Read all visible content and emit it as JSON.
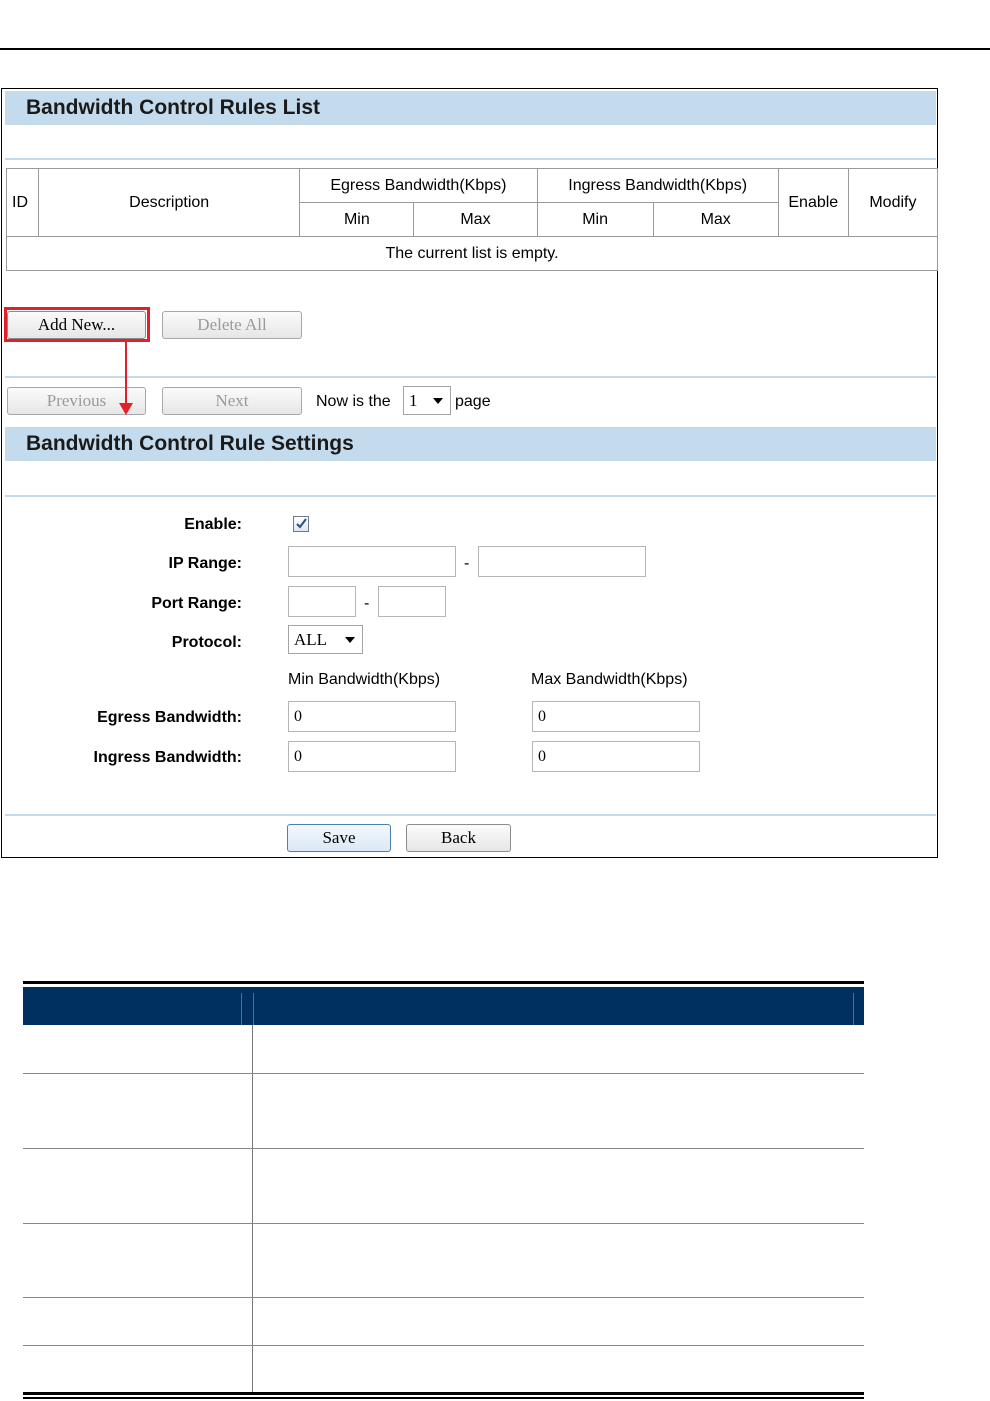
{
  "list_section": {
    "title": "Bandwidth Control Rules List",
    "columns": {
      "id": "ID",
      "description": "Description",
      "egress": "Egress Bandwidth(Kbps)",
      "ingress": "Ingress Bandwidth(Kbps)",
      "min": "Min",
      "max": "Max",
      "enable": "Enable",
      "modify": "Modify"
    },
    "empty_message": "The current list is empty.",
    "add_new_label": "Add New...",
    "delete_all_label": "Delete All",
    "previous_label": "Previous",
    "next_label": "Next",
    "page_prefix": "Now is the",
    "page_value": "1",
    "page_suffix": "page"
  },
  "settings_section": {
    "title": "Bandwidth Control Rule Settings",
    "enable_label": "Enable:",
    "enable_checked": true,
    "ip_range_label": "IP Range:",
    "ip_start": "",
    "ip_end": "",
    "port_range_label": "Port Range:",
    "port_start": "",
    "port_end": "",
    "dash": "-",
    "protocol_label": "Protocol:",
    "protocol_value": "ALL",
    "min_bandwidth_header": "Min Bandwidth(Kbps)",
    "max_bandwidth_header": "Max Bandwidth(Kbps)",
    "egress_label": "Egress Bandwidth:",
    "egress_min": "0",
    "egress_max": "0",
    "ingress_label": "Ingress Bandwidth:",
    "ingress_min": "0",
    "ingress_max": "0",
    "save_label": "Save",
    "back_label": "Back"
  },
  "colors": {
    "section_header": "#c4dbed",
    "highlight": "#e0202a",
    "table_header": "#00305f"
  }
}
